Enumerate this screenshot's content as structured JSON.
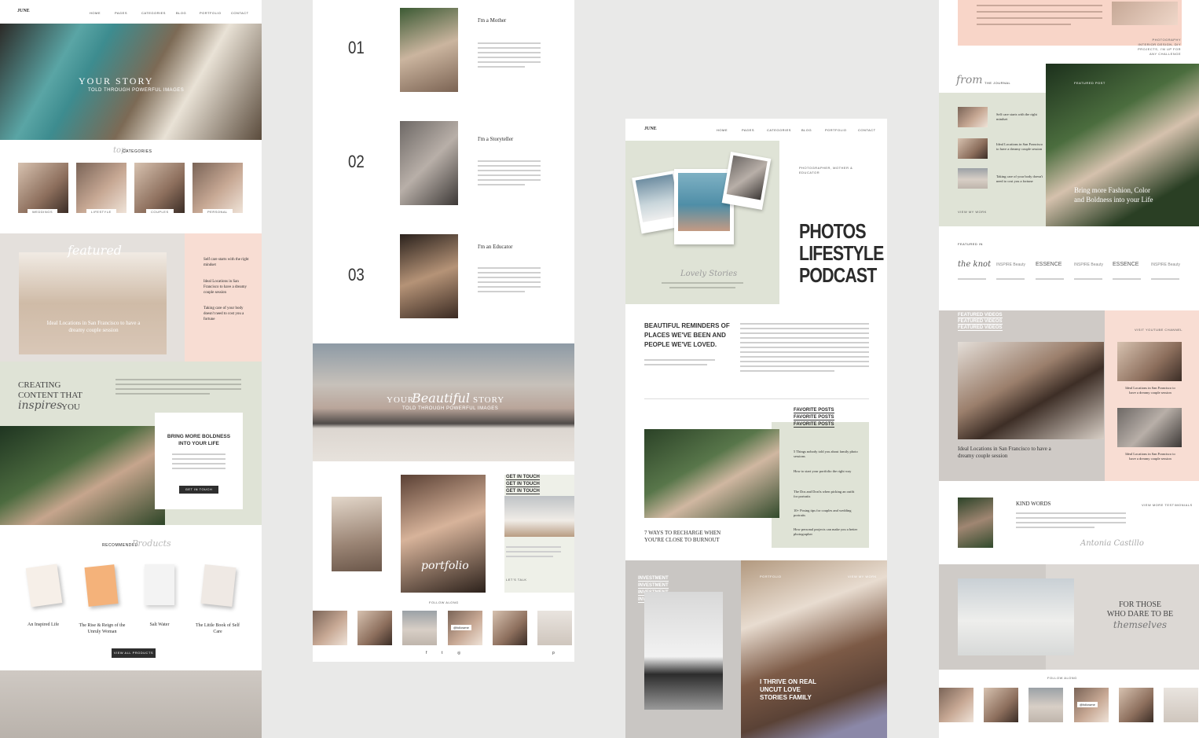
{
  "brand": "JUNE",
  "nav": [
    "HOME",
    "PAGES",
    "CATEGORIES",
    "BLOG",
    "PORTFOLIO",
    "CONTACT"
  ],
  "col1": {
    "hero_title": "YOUR STORY",
    "hero_sub": "TOLD THROUGH POWERFUL IMAGES",
    "categories_script": "top",
    "categories_title": "CATEGORIES",
    "categories": [
      "WEDDINGS",
      "LIFESTYLE",
      "COUPLES",
      "PERSONAL"
    ],
    "featured_script": "featured",
    "featured_caption": "Ideal Locations in San Francisco to have a dreamy couple session",
    "side_posts": [
      "Self care starts with the right mindset",
      "Ideal Locations in San Francisco to have a dreamy couple session",
      "Taking care of your body doesn't need to cost you a fortune"
    ],
    "creating_line1": "CREATING",
    "creating_line2": "CONTENT THAT",
    "creating_script": "inspires",
    "creating_you": "YOU",
    "boldness_title": "BRING MORE BOLDNESS INTO YOUR LIFE",
    "boldness_btn": "Get In Touch",
    "recommended_title": "RECOMMENDED",
    "recommended_script": "Products",
    "products": [
      "An Inspired Life",
      "The Rise & Reign of the Unruly Woman",
      "Salt Water",
      "The Little Book of Self Care"
    ],
    "products_btn": "View All Products"
  },
  "col2": {
    "items": [
      {
        "num": "01",
        "title": "I'm a Mother"
      },
      {
        "num": "02",
        "title": "I'm a Storyteller"
      },
      {
        "num": "03",
        "title": "I'm an Educator"
      }
    ],
    "hero_title_a": "YOUR",
    "hero_script": "Beautiful",
    "hero_title_b": "STORY",
    "hero_sub": "TOLD THROUGH POWERFUL IMAGES",
    "touch": [
      "GET IN TOUCH",
      "GET IN TOUCH",
      "GET IN TOUCH"
    ],
    "portfolio_script": "portfolio",
    "follow": "FOLLOW ALONG",
    "handle": "@followme",
    "touch_link": "LET'S TALK"
  },
  "col3": {
    "tagline": "PHOTOGRAPHER, MOTHER & EDUCATOR",
    "headline": [
      "PHOTOS",
      "LIFESTYLE",
      "PODCAST"
    ],
    "lovely_script": "Lovely Stories",
    "reminder": "BEAUTIFUL REMINDERS OF PLACES WE'VE BEEN AND PEOPLE WE'VE LOVED.",
    "fav_posts": [
      "FAVORITE POSTS",
      "FAVORITE POSTS",
      "FAVORITE POSTS"
    ],
    "fav_list": [
      "5 Things nobody told you about family photo sessions",
      "How to start your portfolio the right way",
      "The Dos and Don'ts when picking an outfit for portraits",
      "10+ Posing tips for couples and wedding portraits",
      "How personal projects can make you a better photographer"
    ],
    "recharge": "7 WAYS TO RECHARGE WHEN YOU'RE CLOSE TO BURNOUT",
    "investment": [
      "INVESTMENT",
      "INVESTMENT",
      "INVESTMENT",
      "INVESTMENT"
    ],
    "portfolio_label": "PORTFOLIO",
    "view_more": "VIEW MY WORK",
    "thrive": "I THRIVE ON REAL UNCUT LOVE STORIES FAMILY"
  },
  "col4": {
    "top_note": "PHOTOGRAPHY INTERIOR DESIGN, DIY PROJECTS, I'M UP FOR ANY CHALLENGE",
    "journal_script": "from",
    "journal_title": "THE JOURNAL",
    "journal_posts": [
      "Self care starts with the right mindset",
      "Ideal Locations in San Francisco to have a dreamy couple session",
      "Taking care of your body doesn't need to cost you a fortune"
    ],
    "journal_link": "VIEW MY WORK",
    "featured_post": "FEATURED POST",
    "bring_more": "Bring more Fashion, Color and Boldness into your Life",
    "featured_in": "FEATURED IN",
    "logos": [
      "the knot",
      "INSPIRE Beauty",
      "ESSENCE",
      "INSPIRE Beauty",
      "ESSENCE",
      "INSPIRE Beauty"
    ],
    "featured_videos": [
      "FEATURED VIDEOS",
      "FEATURED VIDEOS",
      "FEATURED VIDEOS"
    ],
    "visit_channel": "VISIT YOUTUBE CHANNEL",
    "video_caption": "Ideal Locations in San Francisco to have a dreamy couple session",
    "video_side": [
      "Ideal Locations in San Francisco to have a dreamy couple session",
      "Ideal Locations in San Francisco to have a dreamy couple session"
    ],
    "kind_words": "KIND WORDS",
    "view_testimonials": "VIEW MORE TESTIMONIALS",
    "signature": "Antonia Castillo",
    "for_those_1": "FOR THOSE",
    "for_those_2": "WHO DARE TO BE",
    "for_those_script": "themselves",
    "follow": "FOLLOW ALONG",
    "handle": "@followme"
  }
}
